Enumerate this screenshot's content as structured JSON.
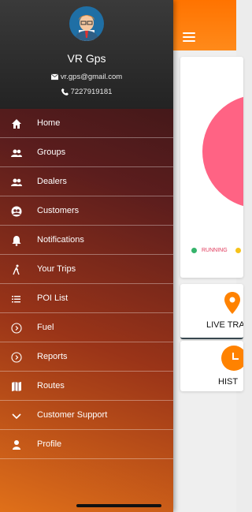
{
  "colors": {
    "accent": "#ff7a00",
    "chart_pink": "#ff6384",
    "running": "#35b36b",
    "idle": "#f6c21a"
  },
  "user": {
    "name": "VR Gps",
    "email": "vr.gps@gmail.com",
    "phone": "7227919181"
  },
  "menu": [
    {
      "label": "Home",
      "icon": "home-icon"
    },
    {
      "label": "Groups",
      "icon": "groups-icon"
    },
    {
      "label": "Dealers",
      "icon": "dealers-icon"
    },
    {
      "label": "Customers",
      "icon": "customers-icon"
    },
    {
      "label": "Notifications",
      "icon": "bell-icon"
    },
    {
      "label": "Your Trips",
      "icon": "walking-person-icon"
    },
    {
      "label": "POI List",
      "icon": "list-icon"
    },
    {
      "label": "Fuel",
      "icon": "chevron-circle-icon"
    },
    {
      "label": "Reports",
      "icon": "chevron-circle-icon"
    },
    {
      "label": "Routes",
      "icon": "map-icon"
    },
    {
      "label": "Customer Support",
      "icon": "chevron-down-icon"
    },
    {
      "label": "Profile",
      "icon": "person-icon"
    }
  ],
  "dashboard": {
    "legend_running": "RUNNING",
    "tile_live": "LIVE TRA",
    "tile_history": "HIST"
  }
}
